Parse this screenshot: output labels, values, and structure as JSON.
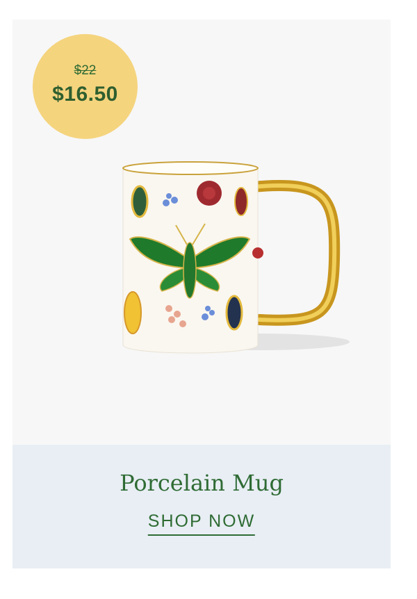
{
  "product": {
    "original_price": "$22",
    "sale_price": "$16.50",
    "name": "Porcelain Mug",
    "cta_label": "SHOP NOW"
  },
  "colors": {
    "badge_bg": "#f5d47e",
    "accent_green": "#2f6b34",
    "info_bg": "#e8eef4",
    "image_bg": "#f7f7f7"
  },
  "icons": [
    "product-image"
  ]
}
